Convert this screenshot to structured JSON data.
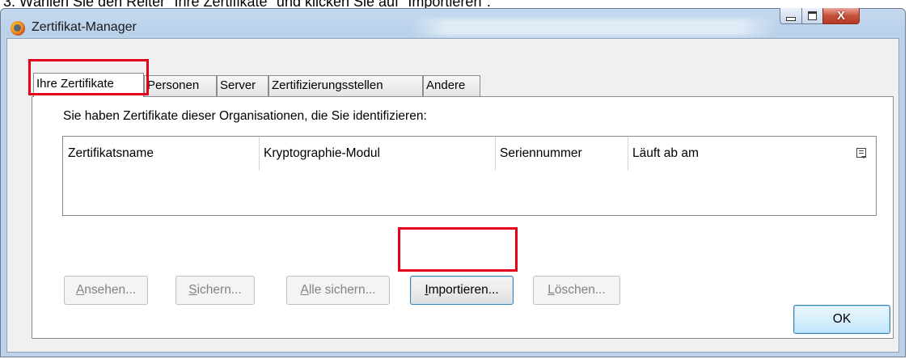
{
  "instruction": "3.   Wählen Sie den Reiter \"Ihre Zertifikate\" und klicken Sie auf \"Importieren\".",
  "window": {
    "title": "Zertifikat-Manager",
    "controls": {
      "minimize_icon": "minimize-icon",
      "maximize_icon": "maximize-icon",
      "close_icon": "close-icon",
      "close_glyph": "X"
    }
  },
  "tabs": [
    {
      "label": "Ihre Zertifikate",
      "active": true
    },
    {
      "label": "Personen",
      "active": false
    },
    {
      "label": "Server",
      "active": false
    },
    {
      "label": "Zertifizierungsstellen",
      "active": false
    },
    {
      "label": "Andere",
      "active": false
    }
  ],
  "panel": {
    "description": "Sie haben Zertifikate dieser Organisationen, die Sie identifizieren:",
    "columns": [
      "Zertifikatsname",
      "Kryptographie-Modul",
      "Seriennummer",
      "Läuft ab am"
    ],
    "rows": [],
    "buttons": [
      {
        "label": "Ansehen...",
        "accel": "A",
        "rest": "nsehen...",
        "enabled": false
      },
      {
        "label": "Sichern...",
        "accel": "S",
        "rest": "ichern...",
        "enabled": false
      },
      {
        "label": "Alle sichern...",
        "accel": "A",
        "rest": "lle sichern...",
        "enabled": false
      },
      {
        "label": "Importieren...",
        "accel": "I",
        "rest": "mportieren...",
        "enabled": true
      },
      {
        "label": "Löschen...",
        "accel": "L",
        "rest": "öschen...",
        "enabled": false
      }
    ]
  },
  "dialog": {
    "ok_label": "OK"
  },
  "colors": {
    "highlight": "#e3001b",
    "window_frame": "#b9d1ea",
    "close_button": "#c7503b"
  }
}
